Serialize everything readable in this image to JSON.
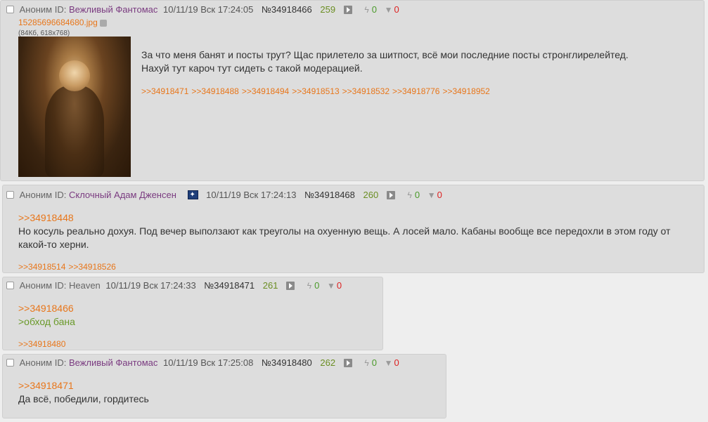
{
  "posts": [
    {
      "anon": "Аноним",
      "id_label": "ID:",
      "name": "Вежливый Фантомас",
      "date": "10/11/19 Вск 17:24:05",
      "num": "№34918466",
      "count": "259",
      "likes": "0",
      "dislikes": "0",
      "file_name": "15285696684680.jpg",
      "file_meta": "(84Кб, 618x768)",
      "text": "За что меня банят и посты трут? Щас прилетело за шитпост, всё мои последние посты стронглирелейтед. Нахуй тут кароч тут сидеть с такой модерацией.",
      "replies": [
        ">>34918471",
        ">>34918488",
        ">>34918494",
        ">>34918513",
        ">>34918532",
        ">>34918776",
        ">>34918952"
      ]
    },
    {
      "anon": "Аноним",
      "id_label": "ID:",
      "name": "Склочный Адам Дженсен",
      "date": "10/11/19 Вск 17:24:13",
      "num": "№34918468",
      "count": "260",
      "likes": "0",
      "dislikes": "0",
      "quote": ">>34918448",
      "text": "Но косуль реально дохуя. Под вечер выползают как треуголы на охуенную вещь. А лосей мало. Кабаны вообще все передохли в этом году от какой-то херни.",
      "replies": [
        ">>34918514",
        ">>34918526"
      ]
    },
    {
      "anon": "Аноним",
      "id_label": "ID:",
      "name": "Heaven",
      "date": "10/11/19 Вск 17:24:33",
      "num": "№34918471",
      "count": "261",
      "likes": "0",
      "dislikes": "0",
      "quote": ">>34918466",
      "greentext": ">обход бана",
      "replies": [
        ">>34918480"
      ]
    },
    {
      "anon": "Аноним",
      "id_label": "ID:",
      "name": "Вежливый Фантомас",
      "date": "10/11/19 Вск 17:25:08",
      "num": "№34918480",
      "count": "262",
      "likes": "0",
      "dislikes": "0",
      "quote": ">>34918471",
      "text": "Да всё, победили, гордитесь"
    }
  ]
}
